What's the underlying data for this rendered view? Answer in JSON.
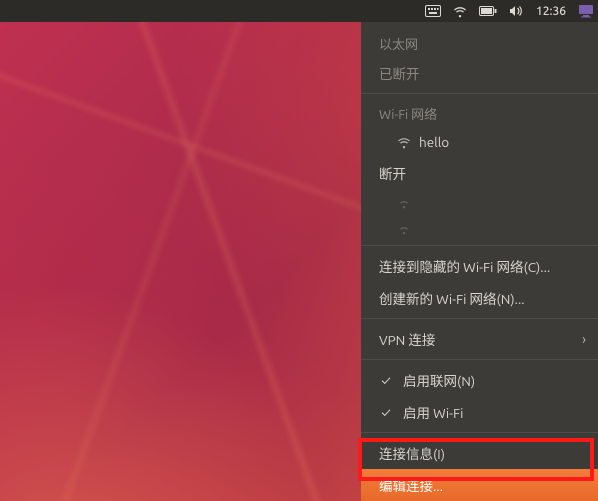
{
  "topbar": {
    "time": "12:36"
  },
  "menu": {
    "ethernet_header": "以太网",
    "ethernet_disconnected": "已断开",
    "wifi_header": "Wi-Fi 网络",
    "wifi_network": "hello",
    "wifi_disconnect": "断开",
    "connect_hidden": "连接到隐藏的 Wi-Fi 网络(C)...",
    "create_new": "创建新的 Wi-Fi 网络(N)...",
    "vpn": "VPN 连接",
    "enable_networking": "启用联网(N)",
    "enable_wifi": "启用 Wi-Fi",
    "connection_info": "连接信息(I)",
    "edit_connections": "编辑连接..."
  }
}
